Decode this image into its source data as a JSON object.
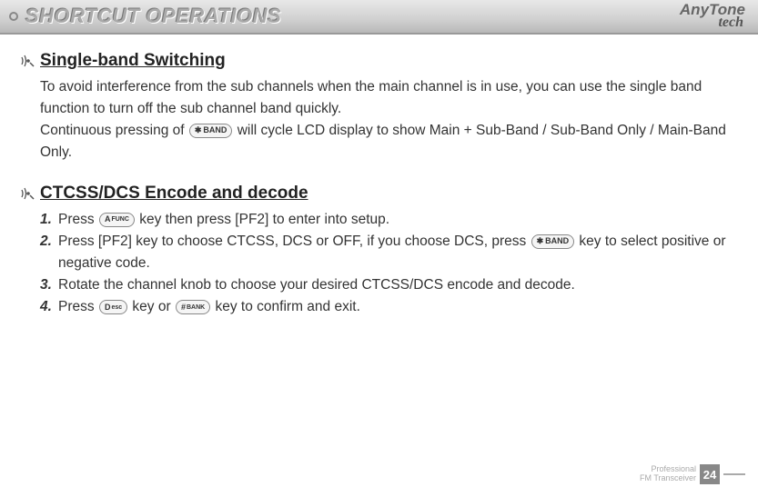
{
  "header": {
    "title": "SHORTCUT OPERATIONS",
    "brand_top": "AnyTone",
    "brand_bottom": "tech"
  },
  "sections": [
    {
      "title": "Single-band Switching",
      "para1": "To avoid interference from the sub channels when the main channel is in use, you can use the single band function to turn off the sub channel band quickly.",
      "para2a": "Continuous pressing of ",
      "key_band": "BAND",
      "para2b": " will cycle LCD display to show Main + Sub-Band / Sub-Band Only / Main-Band Only."
    },
    {
      "title": "CTCSS/DCS Encode and decode",
      "items": [
        {
          "n": "1.",
          "a": "Press ",
          "key1_top": "A",
          "key1_sub": "FUNC",
          "b": " key then press [PF2] to enter into setup."
        },
        {
          "n": "2.",
          "a": "Press [PF2] key to choose CTCSS, DCS or OFF, if you choose DCS, press ",
          "key_band": "BAND",
          "b": " key to select positive or negative code."
        },
        {
          "n": "3.",
          "a": "Rotate the channel knob to choose your desired CTCSS/DCS encode and decode."
        },
        {
          "n": "4.",
          "a": "Press ",
          "key1_top": "D",
          "key1_sub": "esc",
          "b": " key or ",
          "key2_top": "#",
          "key2_sub": "BANK",
          "c": " key to confirm and exit."
        }
      ]
    }
  ],
  "footer": {
    "line1": "Professional",
    "line2": "FM Transceiver",
    "page": "24"
  }
}
